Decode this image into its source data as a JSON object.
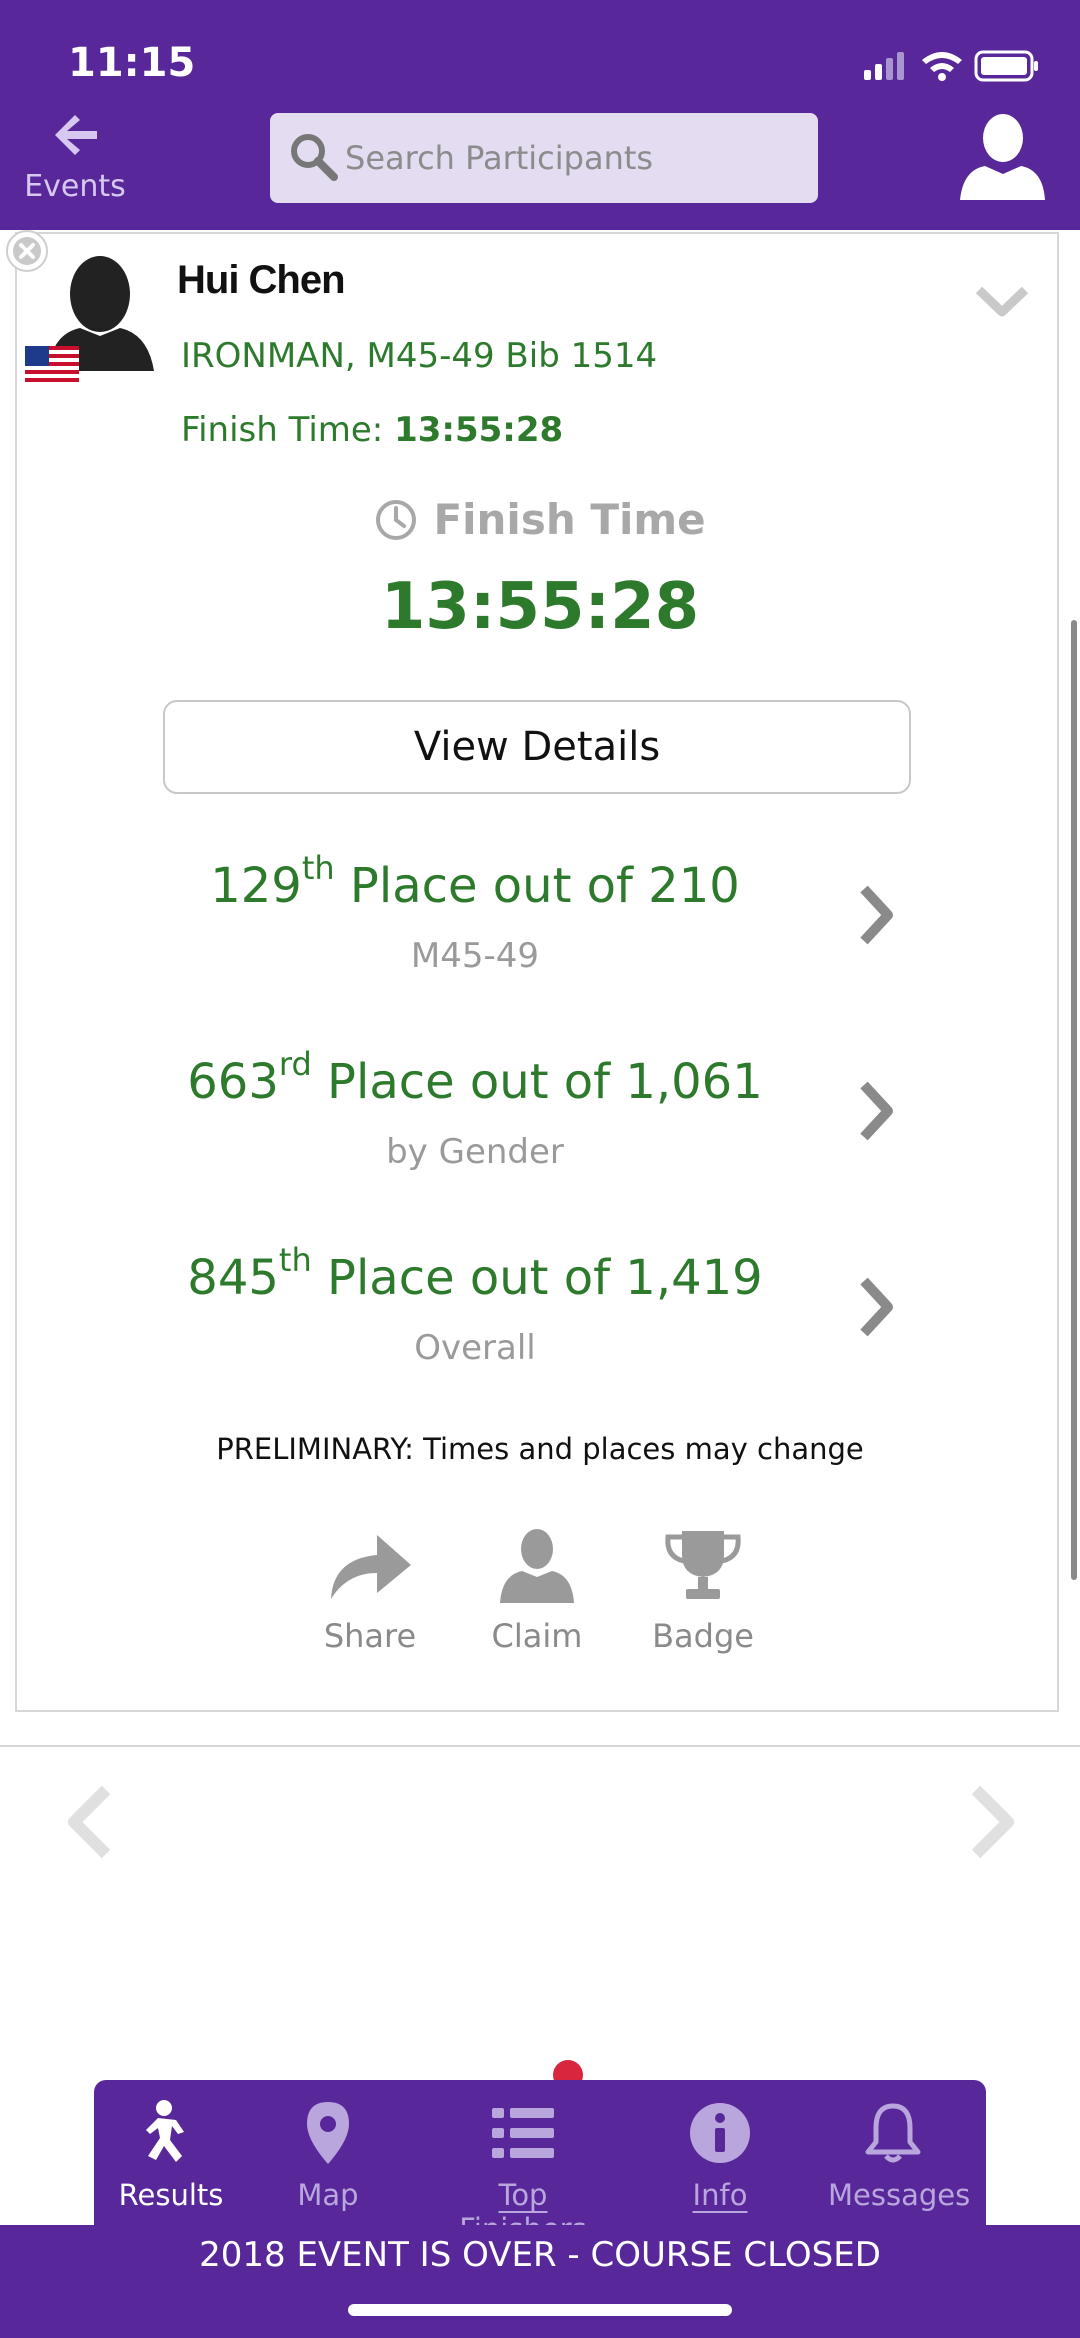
{
  "status_bar": {
    "time": "11:15"
  },
  "header": {
    "back_label": "Events",
    "search_placeholder": "Search Participants"
  },
  "participant": {
    "name": "Hui Chen",
    "division": "IRONMAN, M45-49 Bib 1514",
    "finish_prefix": "Finish Time:",
    "finish_value": "13:55:28"
  },
  "finish": {
    "label": "Finish Time",
    "value": "13:55:28"
  },
  "view_details_label": "View Details",
  "places": [
    {
      "num": "129",
      "suffix": "th",
      "text": "Place out of 210",
      "sub": "M45-49"
    },
    {
      "num": "663",
      "suffix": "rd",
      "text": "Place out of 1,061",
      "sub": "by Gender"
    },
    {
      "num": "845",
      "suffix": "th",
      "text": "Place out of 1,419",
      "sub": "Overall"
    }
  ],
  "prelim_note": "PRELIMINARY: Times and places may change",
  "actions": {
    "share": "Share",
    "claim": "Claim",
    "badge": "Badge"
  },
  "tabs": [
    {
      "label": "Results",
      "icon": "runner-icon"
    },
    {
      "label": "Map",
      "icon": "map-pin-icon"
    },
    {
      "label": "Top Finishers",
      "icon": "list-icon"
    },
    {
      "label": "Info",
      "icon": "info-icon"
    },
    {
      "label": "Messages",
      "icon": "bell-icon"
    }
  ],
  "banner": "2018 EVENT IS OVER - COURSE CLOSED",
  "colors": {
    "brand_purple": "#58289a",
    "result_green": "#2d7a2d"
  }
}
